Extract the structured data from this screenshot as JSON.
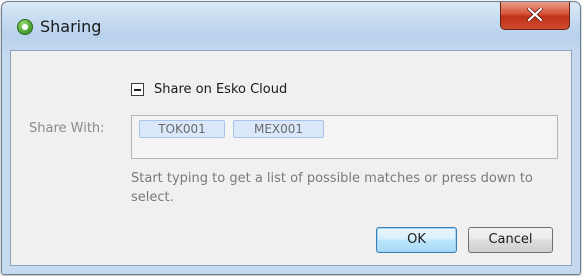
{
  "window": {
    "title": "Sharing",
    "icon": "esko-app-icon",
    "close_icon": "close-x-icon"
  },
  "share": {
    "checkbox_label": "Share on Esko Cloud",
    "checkbox_state": "indeterminate"
  },
  "share_with": {
    "label": "Share With:",
    "tokens": [
      "TOK001",
      "MEX001"
    ],
    "hint": "Start typing to get a list of possible matches or press down to select."
  },
  "buttons": {
    "ok": "OK",
    "cancel": "Cancel"
  },
  "colors": {
    "close_button": "#c9442a",
    "token_bg": "#dbe8fb",
    "default_button": "#bee6fd"
  }
}
